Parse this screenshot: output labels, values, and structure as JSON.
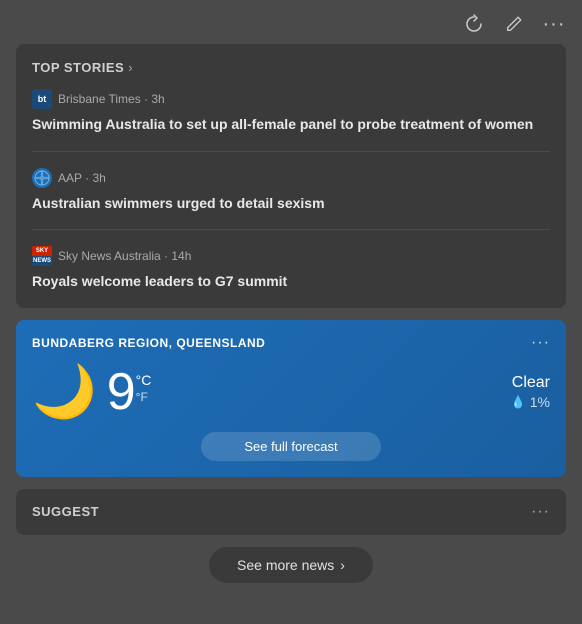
{
  "topBar": {
    "refreshIcon": "↺",
    "editIcon": "✎",
    "moreIcon": "···"
  },
  "topStories": {
    "title": "TOP STORIES",
    "chevron": "›",
    "stories": [
      {
        "sourceName": "Brisbane Times · 3h",
        "sourceLogo": "bt",
        "logoType": "bt",
        "headline": "Swimming Australia to set up all-female panel to probe treatment of women"
      },
      {
        "sourceName": "AAP · 3h",
        "sourceLogo": "AAP",
        "logoType": "aap",
        "headline": "Australian swimmers urged to detail sexism"
      },
      {
        "sourceName": "Sky News Australia · 14h",
        "sourceLogo": "SKY",
        "logoType": "sky",
        "headline": "Royals welcome leaders to G7 summit"
      }
    ]
  },
  "weather": {
    "location": "BUNDABERG REGION, QUEENSLAND",
    "temp": "9",
    "tempUnitPrimary": "°C",
    "tempUnitSecondary": "°F",
    "condition": "Clear",
    "precipLabel": "1%",
    "weatherIcon": "🌙",
    "forecastButtonLabel": "See full forecast",
    "moreIcon": "···"
  },
  "suggested": {
    "label": "SUGGEST",
    "moreIcon": "···"
  },
  "seeMoreNews": {
    "label": "See more news",
    "chevron": "›"
  }
}
